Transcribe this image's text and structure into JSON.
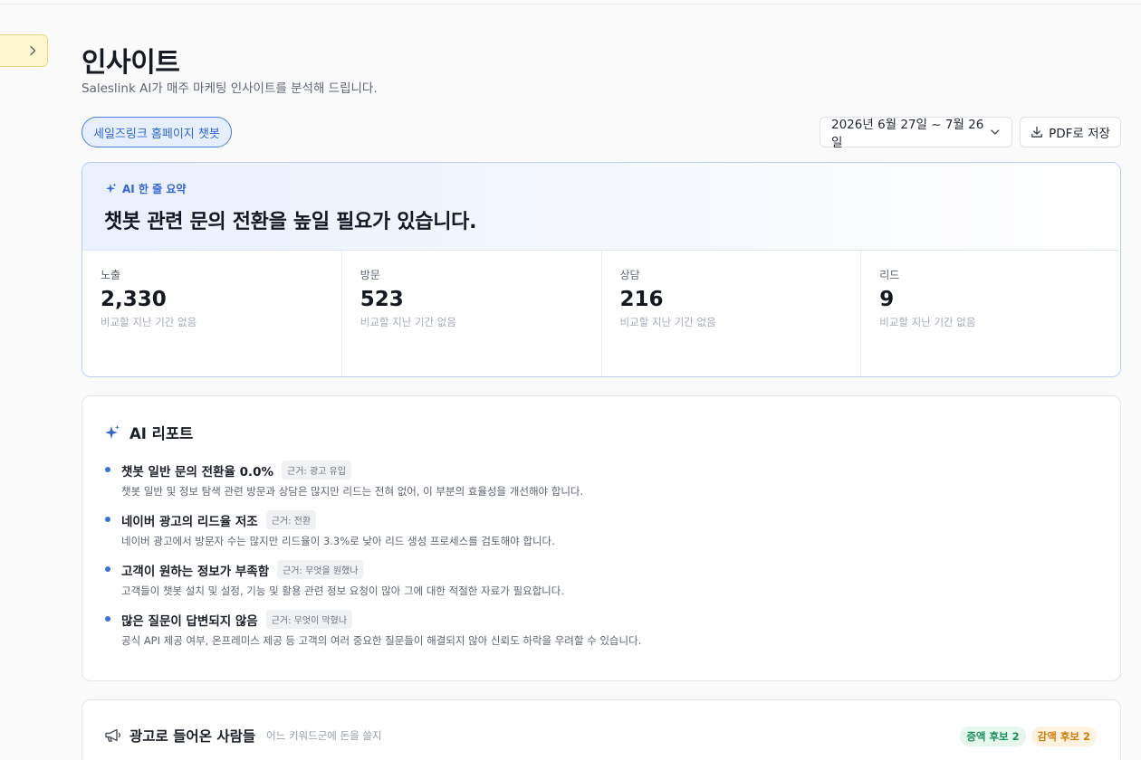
{
  "header": {
    "title": "인사이트",
    "subtitle": "Saleslink AI가 매주 마케팅 인사이트를 분석해 드립니다."
  },
  "filters": {
    "chip_label": "세일즈링크 홈페이지 챗봇",
    "date_range": "2026년 6월 27일 ~ 7월 26일",
    "pdf_label": "PDF로 저장"
  },
  "summary": {
    "tag": "AI 한 줄 요약",
    "headline": "챗봇 관련 문의 전환을 높일 필요가 있습니다.",
    "metrics": [
      {
        "label": "노출",
        "value": "2,330",
        "note": "비교할 지난 기간 없음"
      },
      {
        "label": "방문",
        "value": "523",
        "note": "비교할 지난 기간 없음"
      },
      {
        "label": "상담",
        "value": "216",
        "note": "비교할 지난 기간 없음"
      },
      {
        "label": "리드",
        "value": "9",
        "note": "비교할 지난 기간 없음"
      }
    ]
  },
  "report": {
    "title": "AI 리포트",
    "items": [
      {
        "title": "챗봇 일반 문의 전환율 0.0%",
        "badge": "근거: 광고 유입",
        "desc": "챗봇 일반 및 정보 탐색 관련 방문과 상담은 많지만 리드는 전혀 없어, 이 부분의 효율성을 개선해야 합니다."
      },
      {
        "title": "네이버 광고의 리드율 저조",
        "badge": "근거: 전환",
        "desc": "네이버 광고에서 방문자 수는 많지만 리드율이 3.3%로 낮아 리드 생성 프로세스를 검토해야 합니다."
      },
      {
        "title": "고객이 원하는 정보가 부족함",
        "badge": "근거: 무엇을 원했나",
        "desc": "고객들이 챗봇 설치 및 설정, 기능 및 활용 관련 정보 요청이 많아 그에 대한 적절한 자료가 필요합니다."
      },
      {
        "title": "많은 질문이 답변되지 않음",
        "badge": "근거: 무엇이 막혔나",
        "desc": "공식 API 제공 여부, 온프레미스 제공 등 고객의 여러 중요한 질문들이 해결되지 않아 신뢰도 하락을 우려할 수 있습니다."
      }
    ]
  },
  "ads": {
    "title": "광고로 들어온 사람들",
    "subtitle": "어느 키워드군에 돈을 쓸지",
    "increase_label": "증액 후보 2",
    "decrease_label": "감액 후보 2"
  },
  "colors": {
    "accent": "#2f65d4",
    "positive": "#18915a",
    "warning": "#d27b06"
  },
  "icons": {
    "collapse": "chevron-right-icon",
    "date": "chevron-down-icon",
    "pdf": "download-icon",
    "ai": "sparkle-icon",
    "ads": "megaphone-icon"
  }
}
